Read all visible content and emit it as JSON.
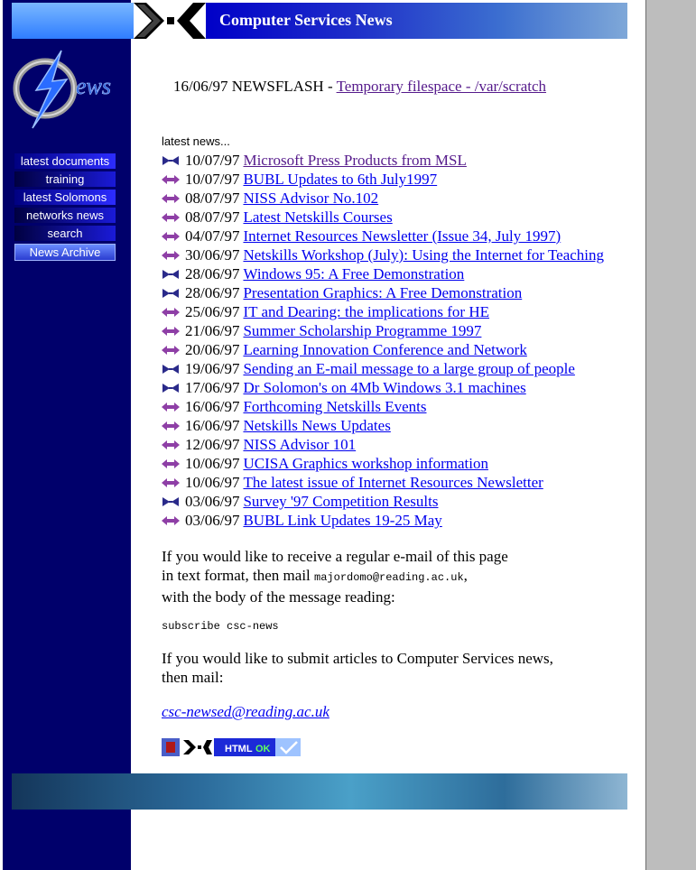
{
  "banner": {
    "title": "Computer Services News"
  },
  "logo": {
    "text": "ews"
  },
  "nav": {
    "items": [
      {
        "label": "latest documents"
      },
      {
        "label": "training"
      },
      {
        "label": "latest Solomons"
      },
      {
        "label": "networks news"
      },
      {
        "label": "search"
      },
      {
        "label": "News Archive"
      }
    ]
  },
  "newsflash": {
    "prefix": "16/06/97 NEWSFLASH -",
    "link": "Temporary filespace - /var/scratch"
  },
  "latest_heading": "latest news...",
  "news": [
    {
      "icon": "bowtie",
      "date": "10/07/97",
      "title": "Microsoft Press Products from MSL",
      "visited": true
    },
    {
      "icon": "arrow",
      "date": "10/07/97",
      "title": "BUBL Updates to 6th July1997",
      "visited": false
    },
    {
      "icon": "arrow",
      "date": "08/07/97",
      "title": "NISS Advisor No.102",
      "visited": false
    },
    {
      "icon": "arrow",
      "date": "08/07/97",
      "title": "Latest Netskills Courses",
      "visited": false
    },
    {
      "icon": "arrow",
      "date": "04/07/97",
      "title": "Internet Resources Newsletter (Issue 34, July 1997)",
      "visited": false
    },
    {
      "icon": "arrow",
      "date": "30/06/97",
      "title": "Netskills Workshop (July): Using the Internet for Teaching",
      "visited": false
    },
    {
      "icon": "bowtie",
      "date": "28/06/97",
      "title": "Windows 95: A Free Demonstration",
      "visited": false
    },
    {
      "icon": "bowtie",
      "date": "28/06/97",
      "title": "Presentation Graphics: A Free Demonstration",
      "visited": false
    },
    {
      "icon": "arrow",
      "date": "25/06/97",
      "title": "IT and Dearing: the implications for HE",
      "visited": false
    },
    {
      "icon": "arrow",
      "date": "21/06/97",
      "title": "Summer Scholarship Programme 1997",
      "visited": false
    },
    {
      "icon": "arrow",
      "date": "20/06/97",
      "title": "Learning Innovation Conference and Network",
      "visited": false
    },
    {
      "icon": "bowtie",
      "date": "19/06/97",
      "title": "Sending an E-mail message to a large group of people",
      "visited": false
    },
    {
      "icon": "bowtie",
      "date": "17/06/97",
      "title": "Dr Solomon's on 4Mb Windows 3.1 machines",
      "visited": false
    },
    {
      "icon": "arrow",
      "date": "16/06/97",
      "title": "Forthcoming Netskills Events",
      "visited": false
    },
    {
      "icon": "arrow",
      "date": "16/06/97",
      "title": "Netskills News Updates",
      "visited": false
    },
    {
      "icon": "arrow",
      "date": "12/06/97",
      "title": "NISS Advisor 101",
      "visited": false
    },
    {
      "icon": "arrow",
      "date": "10/06/97",
      "title": "UCISA Graphics workshop information",
      "visited": false
    },
    {
      "icon": "arrow",
      "date": "10/06/97",
      "title": "The latest issue of Internet Resources Newsletter",
      "visited": false
    },
    {
      "icon": "bowtie",
      "date": "03/06/97",
      "title": "Survey '97 Competition Results",
      "visited": false
    },
    {
      "icon": "arrow",
      "date": "03/06/97",
      "title": "BUBL Link Updates 19-25 May",
      "visited": false
    }
  ],
  "subscribe": {
    "line1": "If you would like to receive a regular e-mail of this page",
    "line2_prefix": "in text format, then mail",
    "address": "majordomo@reading.ac.uk",
    "line2_suffix": ",",
    "line3": "with the body of the message reading:",
    "command": "subscribe csc-news"
  },
  "submit": {
    "line1": "If you would like to submit articles to Computer Services news,",
    "line2": "then mail:",
    "email": "csc-newsed@reading.ac.uk"
  },
  "badge": {
    "text1": "HTML",
    "text2": "OK"
  },
  "colors": {
    "sidebar": "#00006b",
    "link": "#0000ee",
    "visited": "#551a8b",
    "bullet": "#8e3fa6"
  }
}
